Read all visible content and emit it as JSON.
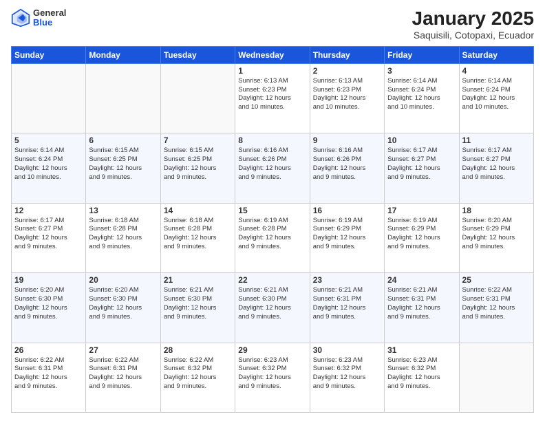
{
  "header": {
    "logo": {
      "general": "General",
      "blue": "Blue"
    },
    "title": "January 2025",
    "subtitle": "Saquisili, Cotopaxi, Ecuador"
  },
  "weekdays": [
    "Sunday",
    "Monday",
    "Tuesday",
    "Wednesday",
    "Thursday",
    "Friday",
    "Saturday"
  ],
  "weeks": [
    [
      {
        "day": "",
        "info": ""
      },
      {
        "day": "",
        "info": ""
      },
      {
        "day": "",
        "info": ""
      },
      {
        "day": "1",
        "info": "Sunrise: 6:13 AM\nSunset: 6:23 PM\nDaylight: 12 hours\nand 10 minutes."
      },
      {
        "day": "2",
        "info": "Sunrise: 6:13 AM\nSunset: 6:23 PM\nDaylight: 12 hours\nand 10 minutes."
      },
      {
        "day": "3",
        "info": "Sunrise: 6:14 AM\nSunset: 6:24 PM\nDaylight: 12 hours\nand 10 minutes."
      },
      {
        "day": "4",
        "info": "Sunrise: 6:14 AM\nSunset: 6:24 PM\nDaylight: 12 hours\nand 10 minutes."
      }
    ],
    [
      {
        "day": "5",
        "info": "Sunrise: 6:14 AM\nSunset: 6:24 PM\nDaylight: 12 hours\nand 10 minutes."
      },
      {
        "day": "6",
        "info": "Sunrise: 6:15 AM\nSunset: 6:25 PM\nDaylight: 12 hours\nand 9 minutes."
      },
      {
        "day": "7",
        "info": "Sunrise: 6:15 AM\nSunset: 6:25 PM\nDaylight: 12 hours\nand 9 minutes."
      },
      {
        "day": "8",
        "info": "Sunrise: 6:16 AM\nSunset: 6:26 PM\nDaylight: 12 hours\nand 9 minutes."
      },
      {
        "day": "9",
        "info": "Sunrise: 6:16 AM\nSunset: 6:26 PM\nDaylight: 12 hours\nand 9 minutes."
      },
      {
        "day": "10",
        "info": "Sunrise: 6:17 AM\nSunset: 6:27 PM\nDaylight: 12 hours\nand 9 minutes."
      },
      {
        "day": "11",
        "info": "Sunrise: 6:17 AM\nSunset: 6:27 PM\nDaylight: 12 hours\nand 9 minutes."
      }
    ],
    [
      {
        "day": "12",
        "info": "Sunrise: 6:17 AM\nSunset: 6:27 PM\nDaylight: 12 hours\nand 9 minutes."
      },
      {
        "day": "13",
        "info": "Sunrise: 6:18 AM\nSunset: 6:28 PM\nDaylight: 12 hours\nand 9 minutes."
      },
      {
        "day": "14",
        "info": "Sunrise: 6:18 AM\nSunset: 6:28 PM\nDaylight: 12 hours\nand 9 minutes."
      },
      {
        "day": "15",
        "info": "Sunrise: 6:19 AM\nSunset: 6:28 PM\nDaylight: 12 hours\nand 9 minutes."
      },
      {
        "day": "16",
        "info": "Sunrise: 6:19 AM\nSunset: 6:29 PM\nDaylight: 12 hours\nand 9 minutes."
      },
      {
        "day": "17",
        "info": "Sunrise: 6:19 AM\nSunset: 6:29 PM\nDaylight: 12 hours\nand 9 minutes."
      },
      {
        "day": "18",
        "info": "Sunrise: 6:20 AM\nSunset: 6:29 PM\nDaylight: 12 hours\nand 9 minutes."
      }
    ],
    [
      {
        "day": "19",
        "info": "Sunrise: 6:20 AM\nSunset: 6:30 PM\nDaylight: 12 hours\nand 9 minutes."
      },
      {
        "day": "20",
        "info": "Sunrise: 6:20 AM\nSunset: 6:30 PM\nDaylight: 12 hours\nand 9 minutes."
      },
      {
        "day": "21",
        "info": "Sunrise: 6:21 AM\nSunset: 6:30 PM\nDaylight: 12 hours\nand 9 minutes."
      },
      {
        "day": "22",
        "info": "Sunrise: 6:21 AM\nSunset: 6:30 PM\nDaylight: 12 hours\nand 9 minutes."
      },
      {
        "day": "23",
        "info": "Sunrise: 6:21 AM\nSunset: 6:31 PM\nDaylight: 12 hours\nand 9 minutes."
      },
      {
        "day": "24",
        "info": "Sunrise: 6:21 AM\nSunset: 6:31 PM\nDaylight: 12 hours\nand 9 minutes."
      },
      {
        "day": "25",
        "info": "Sunrise: 6:22 AM\nSunset: 6:31 PM\nDaylight: 12 hours\nand 9 minutes."
      }
    ],
    [
      {
        "day": "26",
        "info": "Sunrise: 6:22 AM\nSunset: 6:31 PM\nDaylight: 12 hours\nand 9 minutes."
      },
      {
        "day": "27",
        "info": "Sunrise: 6:22 AM\nSunset: 6:31 PM\nDaylight: 12 hours\nand 9 minutes."
      },
      {
        "day": "28",
        "info": "Sunrise: 6:22 AM\nSunset: 6:32 PM\nDaylight: 12 hours\nand 9 minutes."
      },
      {
        "day": "29",
        "info": "Sunrise: 6:23 AM\nSunset: 6:32 PM\nDaylight: 12 hours\nand 9 minutes."
      },
      {
        "day": "30",
        "info": "Sunrise: 6:23 AM\nSunset: 6:32 PM\nDaylight: 12 hours\nand 9 minutes."
      },
      {
        "day": "31",
        "info": "Sunrise: 6:23 AM\nSunset: 6:32 PM\nDaylight: 12 hours\nand 9 minutes."
      },
      {
        "day": "",
        "info": ""
      }
    ]
  ]
}
